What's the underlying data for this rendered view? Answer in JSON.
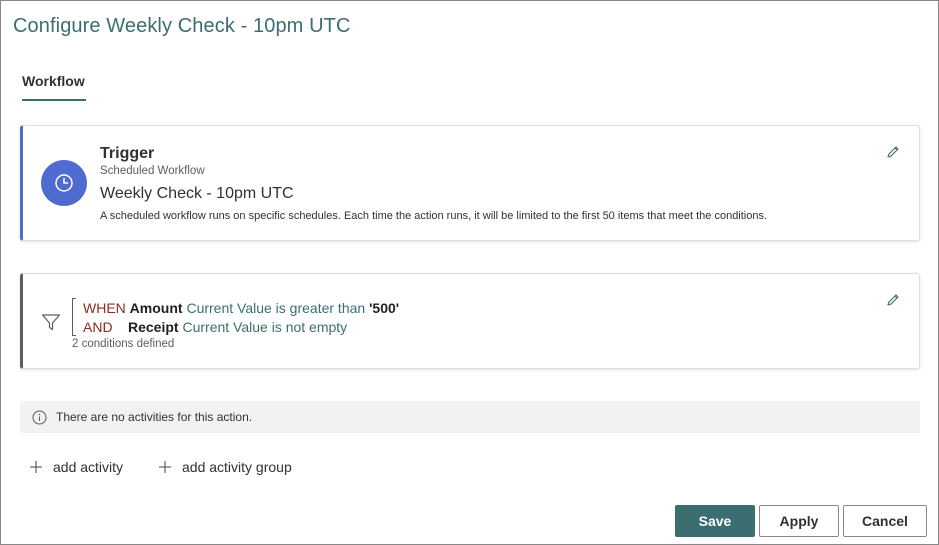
{
  "page": {
    "title": "Configure Weekly Check - 10pm UTC"
  },
  "tabs": [
    {
      "label": "Workflow",
      "active": true
    }
  ],
  "trigger": {
    "heading": "Trigger",
    "type": "Scheduled Workflow",
    "name": "Weekly Check - 10pm UTC",
    "description": "A scheduled workflow runs on specific schedules. Each time the action runs, it will be limited to the first 50 items that meet the conditions.",
    "icon": "clock-icon",
    "accent_color": "#4f6bcf"
  },
  "condition": {
    "icon": "filter-icon",
    "rows": [
      {
        "keyword": "WHEN",
        "field": "Amount",
        "operator": "Current Value is greater than",
        "value": "'500'"
      },
      {
        "keyword": "AND",
        "field": "Receipt",
        "operator": "Current Value is not empty",
        "value": ""
      }
    ],
    "summary": "2 conditions defined"
  },
  "activities": {
    "empty_message": "There are no activities for this action.",
    "add_activity_label": "add activity",
    "add_activity_group_label": "add activity group"
  },
  "footer": {
    "save_label": "Save",
    "apply_label": "Apply",
    "cancel_label": "Cancel"
  },
  "colors": {
    "primary": "#3c6e71",
    "keyword": "#8e2a1f"
  }
}
